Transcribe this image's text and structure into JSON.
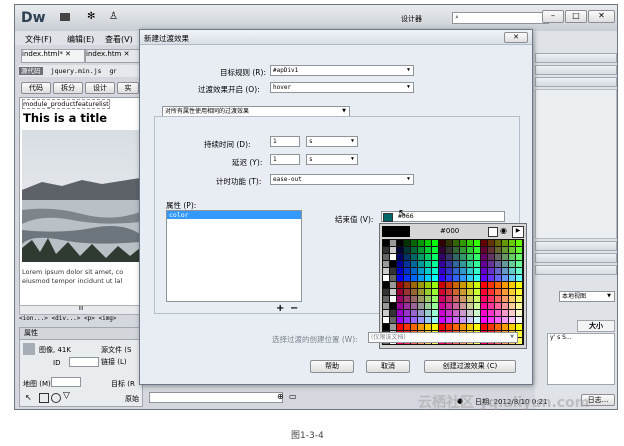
{
  "app": {
    "logo": "Dw",
    "designer_label": "设计器",
    "search_placeholder": ""
  },
  "menu": [
    "文件(F)",
    "编辑(E)",
    "查看(V)"
  ],
  "doc_tabs": [
    "index.html*",
    "index.htm"
  ],
  "related_files": [
    "源代码",
    "jquery.min.js",
    "gr"
  ],
  "view_buttons": [
    "代码",
    "拆分",
    "设计",
    "实"
  ],
  "page": {
    "module_tag": "module_productfeaturelist",
    "title": "This is a title",
    "lorem": "Lorem ipsum dolor sit amet, co eiusmod tempor incidunt ut lal",
    "tag_path": "<ion...> <div...> <p> <img>",
    "ruler": "III"
  },
  "properties": {
    "tab": "属性",
    "image_info": "图像, 41K",
    "src_label": "源文件 (S",
    "link_label": "链接 (L)",
    "id_label": "ID",
    "map_label": "地图 (M)",
    "target_label": "目标 (R",
    "original_label": "原始"
  },
  "dialog": {
    "title": "新建过渡效果",
    "close": "✕",
    "target_rule_label": "目标规则 (R):",
    "target_rule_value": "#apDiv1",
    "transition_on_label": "过渡效果开启 (O):",
    "transition_on_value": "hover",
    "same_transition_value": "对所有属性使用相同的过渡效果",
    "duration_label": "持续时间 (D):",
    "duration_value": "1",
    "duration_unit": "s",
    "delay_label": "延迟 (Y):",
    "delay_value": "1",
    "delay_unit": "s",
    "timing_label": "计时功能 (T):",
    "timing_value": "ease-out",
    "property_label": "属性 (P):",
    "property_items": [
      "color"
    ],
    "add_symbol": "+",
    "remove_symbol": "−",
    "end_value_label": "结束值 (V):",
    "end_value": "#066",
    "picker_hex": "#000",
    "location_label": "选择过渡的创建位置 (W):",
    "location_value": "(仅限该文档)",
    "help_button": "帮助",
    "cancel_button": "取消",
    "create_button": "创建过渡效果 (C)"
  },
  "right_panel": {
    "site_view": "本地视图",
    "size_header": "大小",
    "file_snippet": "y' s S...",
    "date": "日期: 2012/8/10 0:21",
    "log_button": "日志..."
  },
  "caption": "图1-3-4",
  "watermark": "云栖社区 yq.aliyun.com",
  "colors": {
    "dialog_bg": "#e8edf3",
    "selection": "#3399ff",
    "end_color": "#006666"
  }
}
